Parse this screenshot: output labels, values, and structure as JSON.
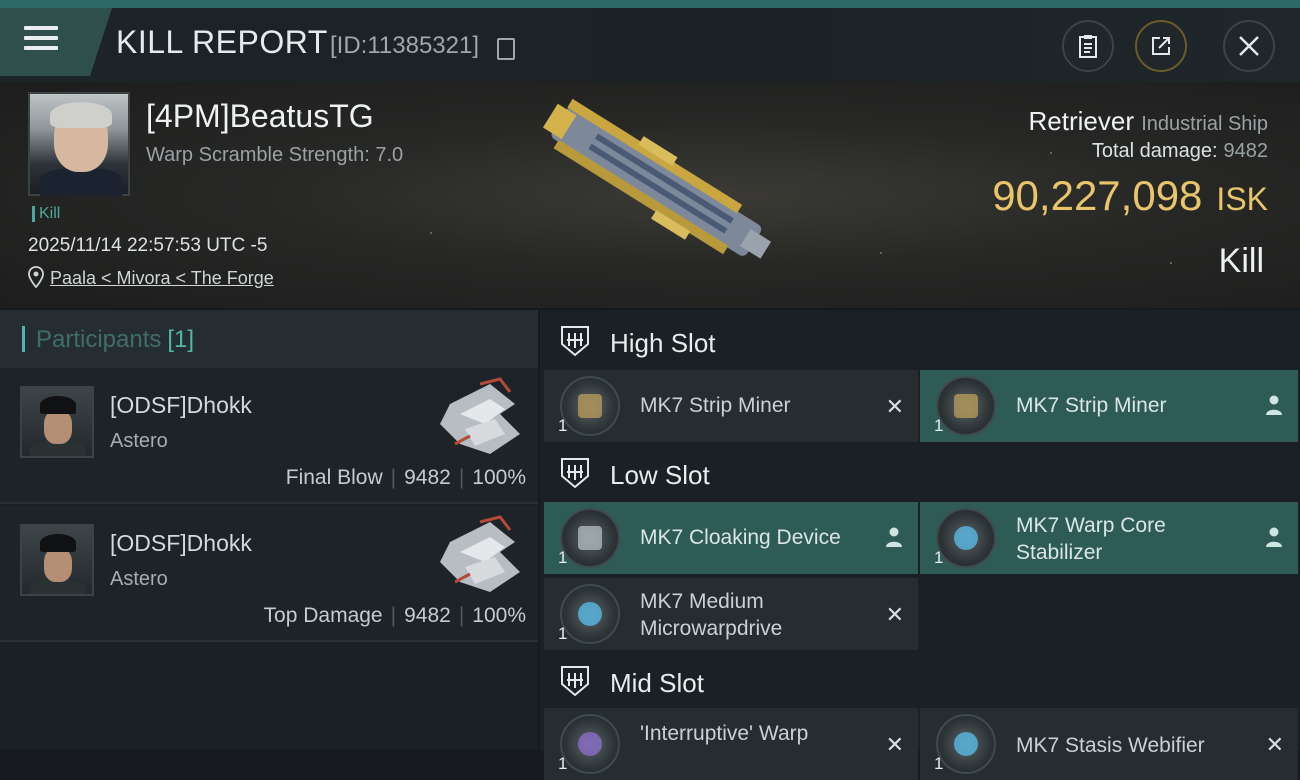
{
  "header": {
    "title": "KILL REPORT",
    "report_id": "[ID:11385321]"
  },
  "victim": {
    "name": "[4PM]BeatusTG",
    "scramble": "Warp Scramble Strength: 7.0",
    "kill_tag": "Kill",
    "datetime": "2025/11/14 22:57:53 UTC -5",
    "location": "Paala < Mivora < The Forge",
    "ship_name": "Retriever",
    "ship_class": "Industrial Ship",
    "total_damage_label": "Total damage:",
    "total_damage": "9482",
    "isk_value": "90,227,098",
    "isk_unit": "ISK",
    "result": "Kill"
  },
  "participants": {
    "label": "Participants",
    "count": "[1]",
    "rows": [
      {
        "name": "[ODSF]Dhokk",
        "ship": "Astero",
        "role": "Final Blow",
        "damage": "9482",
        "percent": "100%"
      },
      {
        "name": "[ODSF]Dhokk",
        "ship": "Astero",
        "role": "Top Damage",
        "damage": "9482",
        "percent": "100%"
      }
    ]
  },
  "slots": {
    "high": {
      "label": "High Slot",
      "modules": [
        {
          "name": "MK7 Strip Miner",
          "qty": "1",
          "status": "destroyed",
          "icon": "strip-miner-icon"
        },
        {
          "name": "MK7 Strip Miner",
          "qty": "1",
          "status": "dropped",
          "icon": "strip-miner-icon"
        }
      ]
    },
    "low": {
      "label": "Low Slot",
      "modules": [
        {
          "name": "MK7 Cloaking Device",
          "qty": "1",
          "status": "dropped",
          "icon": "cloaking-device-icon"
        },
        {
          "name": "MK7 Warp Core Stabilizer",
          "qty": "1",
          "status": "dropped",
          "icon": "warp-core-stabilizer-icon"
        },
        {
          "name": "MK7 Medium Microwarpdrive",
          "qty": "1",
          "status": "destroyed",
          "icon": "microwarpdrive-icon"
        }
      ]
    },
    "mid": {
      "label": "Mid Slot",
      "modules": [
        {
          "name": "'Interruptive' Warp",
          "qty": "1",
          "status": "destroyed",
          "icon": "warp-disruptor-icon"
        },
        {
          "name": "MK7 Stasis Webifier",
          "qty": "1",
          "status": "destroyed",
          "icon": "stasis-webifier-icon"
        }
      ]
    }
  },
  "colors": {
    "accent": "#4fb7a8",
    "isk": "#e8c56a",
    "dropped_bg": "#2f5b57",
    "destroyed_bg": "#262d31"
  }
}
